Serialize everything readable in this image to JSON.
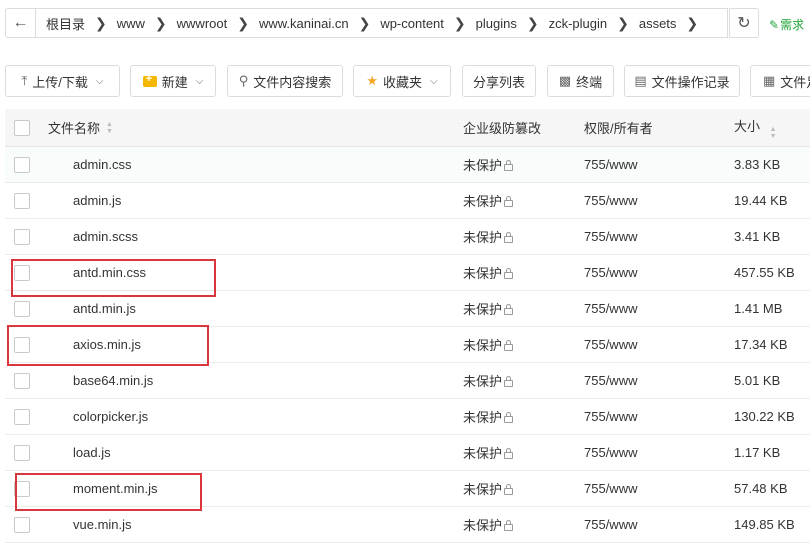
{
  "pathbar": {
    "back_icon": "arrow-left-icon",
    "crumbs": [
      "根目录",
      "www",
      "wwwroot",
      "www.kaninai.cn",
      "wp-content",
      "plugins",
      "zck-plugin",
      "assets"
    ],
    "refresh_icon": "refresh-icon",
    "request_label": "需求"
  },
  "toolbar": {
    "upload_label": "上传/下载",
    "new_label": "新建",
    "search_label": "文件内容搜索",
    "favorites_label": "收藏夹",
    "share_label": "分享列表",
    "terminal_label": "终端",
    "oplog_label": "文件操作记录",
    "more_label": "文件足"
  },
  "table": {
    "headers": {
      "name": "文件名称",
      "enterprise": "企业级防篡改",
      "perm": "权限/所有者",
      "size": "大小"
    },
    "rows": [
      {
        "icon": "css",
        "name": "admin.css",
        "protect": "未保护",
        "perm": "755/www",
        "size": "3.83 KB"
      },
      {
        "icon": "js",
        "name": "admin.js",
        "protect": "未保护",
        "perm": "755/www",
        "size": "19.44 KB"
      },
      {
        "icon": "doc",
        "name": "admin.scss",
        "protect": "未保护",
        "perm": "755/www",
        "size": "3.41 KB"
      },
      {
        "icon": "css",
        "name": "antd.min.css",
        "protect": "未保护",
        "perm": "755/www",
        "size": "457.55 KB"
      },
      {
        "icon": "js",
        "name": "antd.min.js",
        "protect": "未保护",
        "perm": "755/www",
        "size": "1.41 MB"
      },
      {
        "icon": "js",
        "name": "axios.min.js",
        "protect": "未保护",
        "perm": "755/www",
        "size": "17.34 KB"
      },
      {
        "icon": "js",
        "name": "base64.min.js",
        "protect": "未保护",
        "perm": "755/www",
        "size": "5.01 KB"
      },
      {
        "icon": "js",
        "name": "colorpicker.js",
        "protect": "未保护",
        "perm": "755/www",
        "size": "130.22 KB"
      },
      {
        "icon": "js",
        "name": "load.js",
        "protect": "未保护",
        "perm": "755/www",
        "size": "1.17 KB"
      },
      {
        "icon": "js",
        "name": "moment.min.js",
        "protect": "未保护",
        "perm": "755/www",
        "size": "57.48 KB"
      },
      {
        "icon": "js",
        "name": "vue.min.js",
        "protect": "未保护",
        "perm": "755/www",
        "size": "149.85 KB"
      }
    ]
  },
  "highlight_color": "#d9363e"
}
